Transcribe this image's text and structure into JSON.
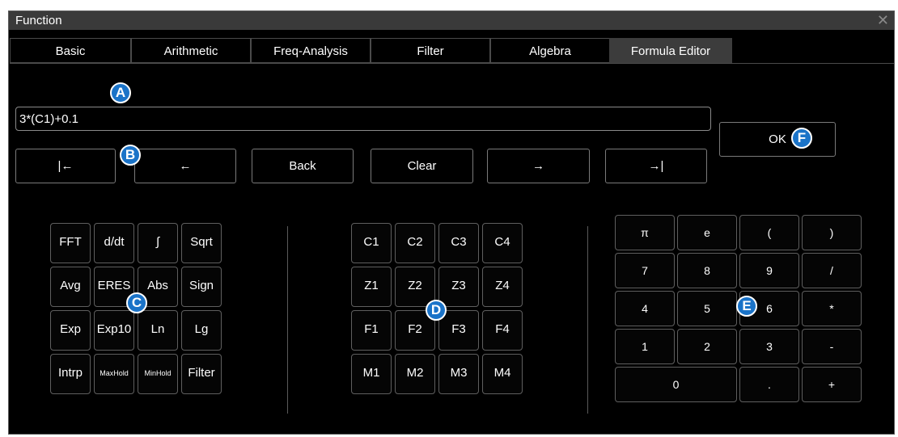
{
  "window": {
    "title": "Function"
  },
  "tabs": [
    {
      "label": "Basic"
    },
    {
      "label": "Arithmetic"
    },
    {
      "label": "Freq-Analysis"
    },
    {
      "label": "Filter"
    },
    {
      "label": "Algebra"
    },
    {
      "label": "Formula Editor",
      "active": true
    }
  ],
  "formula": {
    "value": "3*(C1)+0.1"
  },
  "ok_label": "OK",
  "nav": {
    "home": "|←",
    "left": "←",
    "back": "Back",
    "clear": "Clear",
    "right": "→",
    "end": "→|"
  },
  "functions": [
    [
      "FFT",
      "d/dt",
      "∫",
      "Sqrt"
    ],
    [
      "Avg",
      "ERES",
      "Abs",
      "Sign"
    ],
    [
      "Exp",
      "Exp10",
      "Ln",
      "Lg"
    ],
    [
      "Intrp",
      "MaxHold",
      "MinHold",
      "Filter"
    ]
  ],
  "sources": [
    [
      "C1",
      "C2",
      "C3",
      "C4"
    ],
    [
      "Z1",
      "Z2",
      "Z3",
      "Z4"
    ],
    [
      "F1",
      "F2",
      "F3",
      "F4"
    ],
    [
      "M1",
      "M2",
      "M3",
      "M4"
    ]
  ],
  "keypad": [
    [
      "π",
      "e",
      "(",
      ")"
    ],
    [
      "7",
      "8",
      "9",
      "/"
    ],
    [
      "4",
      "5",
      "6",
      "*"
    ],
    [
      "1",
      "2",
      "3",
      "-"
    ],
    [
      "0",
      ".",
      "+"
    ]
  ],
  "badges": {
    "a": "A",
    "b": "B",
    "c": "C",
    "d": "D",
    "e": "E",
    "f": "F"
  },
  "colors": {
    "badge": "#1a73c8",
    "background": "#000000",
    "tab_active": "#3c3c3c"
  }
}
